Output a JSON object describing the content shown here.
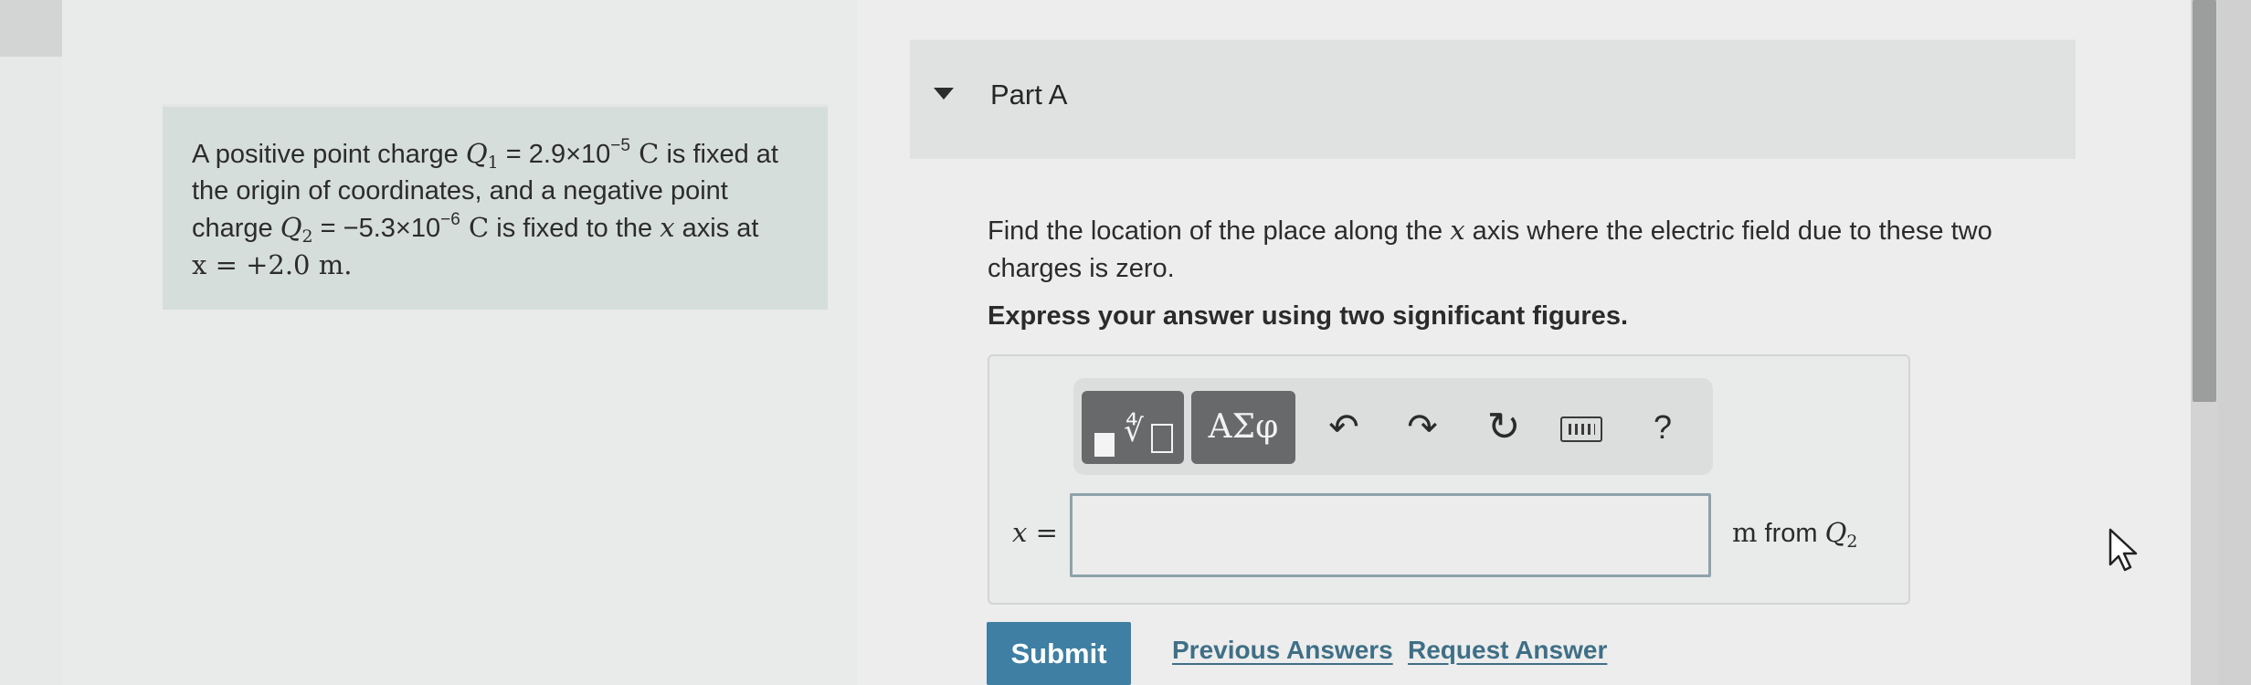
{
  "problem": {
    "line1_pre": "A positive point charge ",
    "q1_symbol": "Q",
    "q1_sub": "1",
    "q1_value_pre": " = 2.9×10",
    "q1_exp": "−5",
    "q1_unit": " C",
    "line1_post": " is fixed at",
    "line2": "the origin of coordinates, and a negative point",
    "line3_pre": "charge ",
    "q2_symbol": "Q",
    "q2_sub": "2",
    "q2_value_pre": " = −5.3×10",
    "q2_exp": "−6",
    "q2_unit": " C",
    "line3_post": " is fixed to the ",
    "x_var": "x",
    "line3_end": " axis at",
    "line4": "x = +2.0 m."
  },
  "part": {
    "title": "Part A",
    "question_pre": "Find the location of the place along the ",
    "question_var": "x",
    "question_post": " axis where the electric field due to these two charges is zero.",
    "instruction": "Express your answer using two significant figures."
  },
  "toolbar": {
    "symbols_label": "ΑΣφ",
    "undo_glyph": "↶",
    "redo_glyph": "↷",
    "reset_glyph": "↻",
    "help_glyph": "?"
  },
  "answer": {
    "var_label": "x =",
    "input_value": "",
    "unit_pre": "m",
    "unit_mid": " from ",
    "unit_sym": "Q",
    "unit_sub": "2"
  },
  "actions": {
    "submit_label": "Submit",
    "previous_answers_label": "Previous Answers",
    "request_answer_label": "Request Answer"
  }
}
